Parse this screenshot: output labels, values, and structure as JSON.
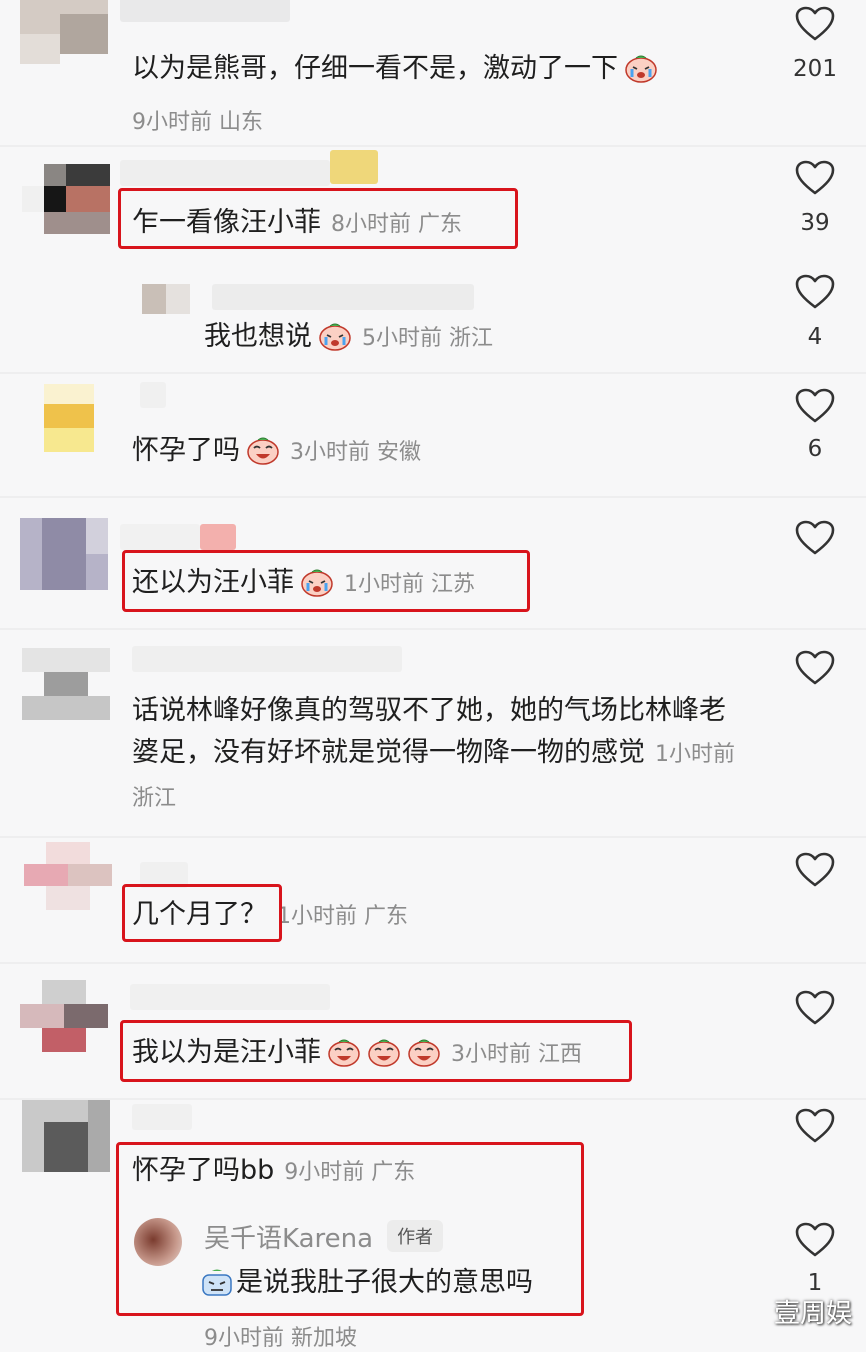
{
  "comments": [
    {
      "text": "以为是熊哥，仔细一看不是，激动了一下",
      "time": "9小时前",
      "location": "山东",
      "likes": "201",
      "emoji": "cry-face"
    },
    {
      "text": "乍一看像汪小菲",
      "time": "8小时前",
      "location": "广东",
      "likes": "39"
    },
    {
      "text": "我也想说",
      "time": "5小时前",
      "location": "浙江",
      "likes": "4",
      "emoji": "cry-face"
    },
    {
      "text": "怀孕了吗",
      "time": "3小时前",
      "location": "安徽",
      "likes": "6",
      "emoji": "laugh-cry-face"
    },
    {
      "text": "还以为汪小菲",
      "time": "1小时前",
      "location": "江苏",
      "likes": "",
      "emoji": "cry-face"
    },
    {
      "text": "话说林峰好像真的驾驭不了她，她的气场比林峰老婆足，没有好坏就是觉得一物降一物的感觉",
      "time": "1小时前",
      "location": "浙江",
      "likes": ""
    },
    {
      "text": "几个月了？",
      "time": "1小时前",
      "location": "广东",
      "likes": ""
    },
    {
      "text": "我以为是汪小菲",
      "time": "3小时前",
      "location": "江西",
      "likes": "",
      "emoji": "laugh-cry-face"
    },
    {
      "text": "怀孕了吗bb",
      "time": "9小时前",
      "location": "广东",
      "likes": "1"
    }
  ],
  "author_reply": {
    "name": "吴千语Karena",
    "tag": "作者",
    "text": "是说我肚子很大的意思吗",
    "time": "9小时前",
    "location": "新加坡",
    "emoji": "sweat-face"
  },
  "watermark": "壹周娱",
  "colors": {
    "highlight_box": "#d8141c",
    "meta_text": "#8c8c8c",
    "background": "#f7f7f8"
  }
}
